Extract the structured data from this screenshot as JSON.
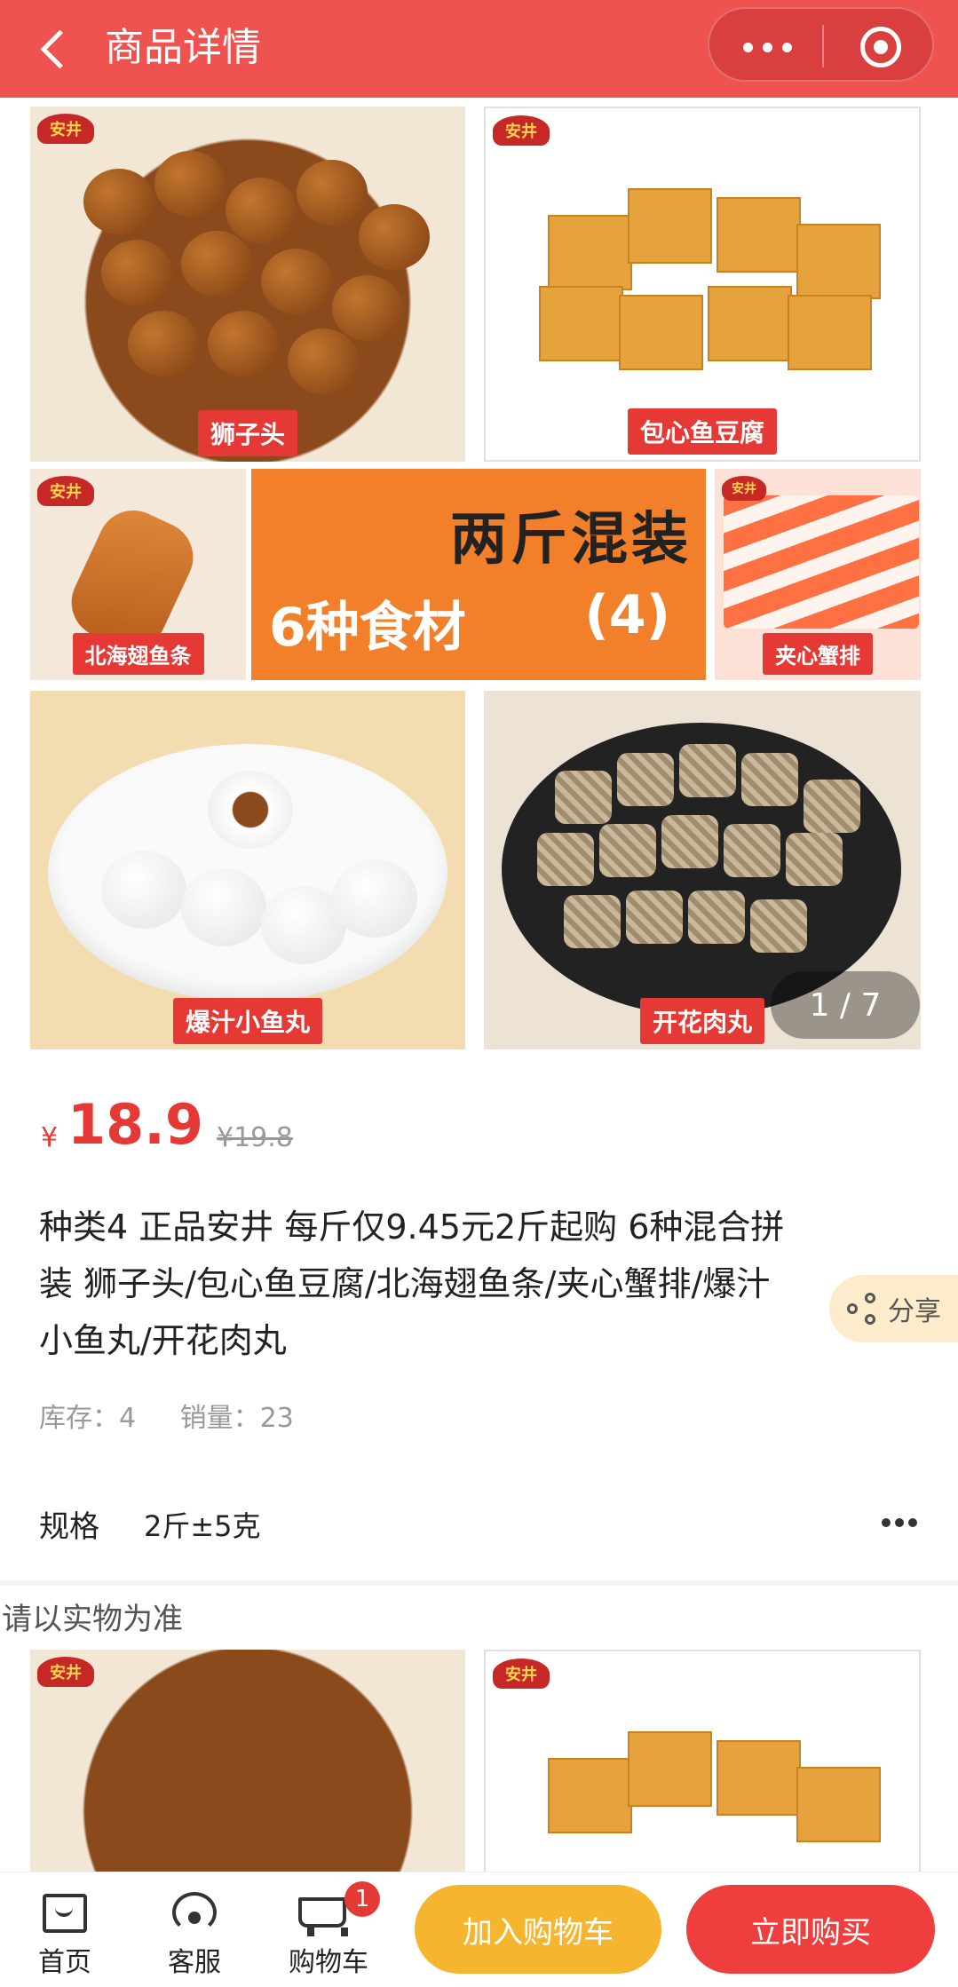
{
  "header": {
    "title": "商品详情"
  },
  "gallery": {
    "brand": "安井",
    "captions": [
      "狮子头",
      "包心鱼豆腐",
      "北海翅鱼条",
      "夹心蟹排",
      "爆汁小鱼丸",
      "开花肉丸"
    ],
    "banner_title": "两斤混装",
    "banner_sub": "6种食材",
    "banner_num": "(4)",
    "pager": "1 / 7"
  },
  "product": {
    "currency": "¥",
    "price": "18.9",
    "old_price": "¥19.8",
    "name": "种类4 正品安井 每斤仅9.45元2斤起购 6种混合拼装 狮子头/包心鱼豆腐/北海翅鱼条/夹心蟹排/爆汁小鱼丸/开花肉丸",
    "stock": "库存：4",
    "sales": "销量：23"
  },
  "share": {
    "label": "分享"
  },
  "spec": {
    "key": "规格",
    "value": "2斤±5克"
  },
  "note": "请以实物为准",
  "bottom_nav": {
    "home": "首页",
    "service": "客服",
    "cart": "购物车",
    "cart_badge": "1",
    "add_to_cart": "加入购物车",
    "buy_now": "立即购买"
  }
}
